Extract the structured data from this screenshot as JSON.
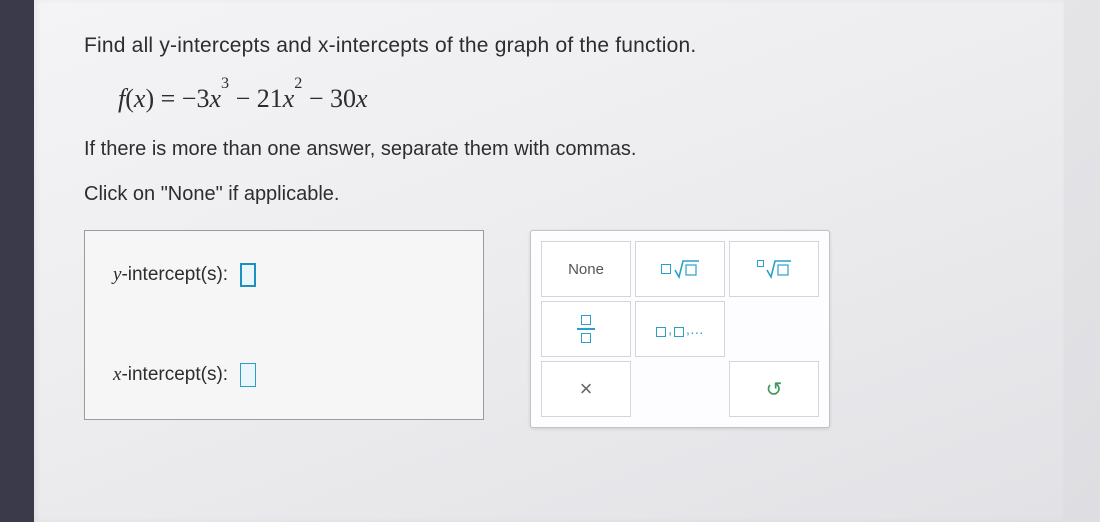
{
  "question": {
    "line1": "Find all y-intercepts and x-intercepts of the graph of the function.",
    "line2": "If there is more than one answer, separate them with commas.",
    "line3": "Click on \"None\" if applicable."
  },
  "formula": {
    "lhs": "f(x)",
    "rhs_display": "−3x³ − 21x² − 30x",
    "coeffs": {
      "a": -3,
      "b": -21,
      "c": -30,
      "d": 0
    }
  },
  "answers": {
    "y_label_var": "y",
    "x_label_var": "x",
    "label_suffix": "-intercept(s):"
  },
  "keypad": {
    "none": "None",
    "sqrt_title": "square root",
    "nroot_title": "nth root",
    "frac_title": "fraction",
    "list_title": "list",
    "clear_title": "clear",
    "reset_title": "reset",
    "list_text": ",…",
    "clear_glyph": "×",
    "reset_glyph": "↺"
  }
}
